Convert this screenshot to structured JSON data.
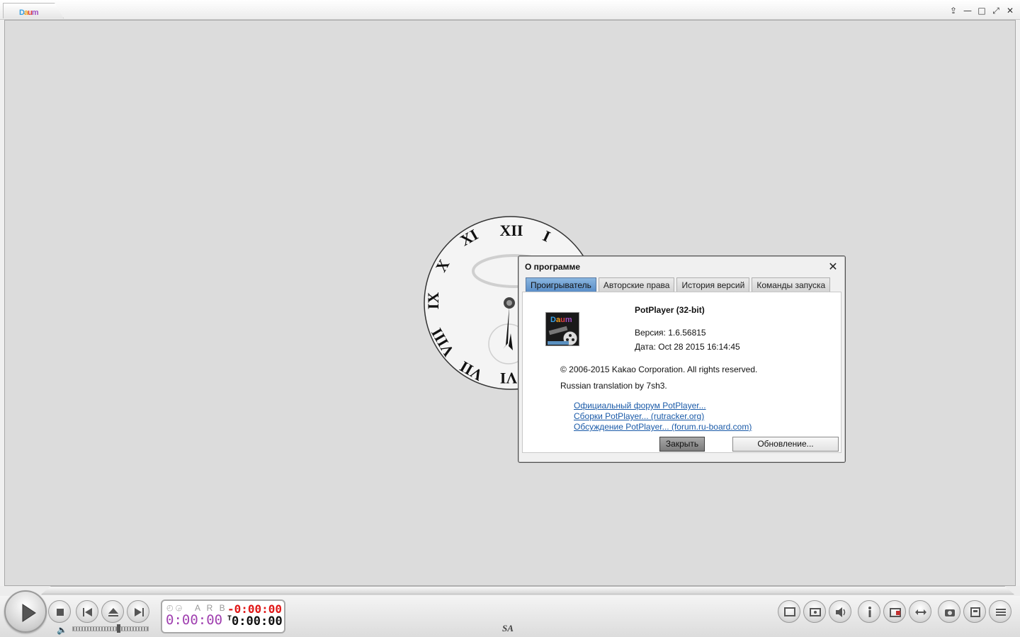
{
  "titlebar": {
    "logo_letters": [
      "D",
      "a",
      "u",
      "m"
    ],
    "buttons": [
      "⇪",
      "—",
      "□",
      "⤢",
      "✕"
    ]
  },
  "dialog": {
    "title": "О программе",
    "close": "✕",
    "tabs": [
      "Проигрыватель",
      "Авторские права",
      "История версий",
      "Команды запуска"
    ],
    "active_tab": 0,
    "product": "PotPlayer (32-bit)",
    "version": "Версия: 1.6.56815",
    "date": "Дата: Oct 28 2015 16:14:45",
    "copyright": "© 2006-2015 Kakao Corporation. All rights reserved.",
    "translation": "Russian translation by 7sh3.",
    "links": [
      "Официальный форум PotPlayer...",
      "Сборки PotPlayer... (rutracker.org)",
      "Обсуждение PotPlayer... (forum.ru-board.com)"
    ],
    "close_button": "Закрыть",
    "update_button": "Обновление..."
  },
  "clock": {
    "numerals": [
      "XII",
      "I",
      "XI",
      "X",
      "IX",
      "VIII",
      "VII",
      "VI"
    ]
  },
  "player": {
    "arb": "A R B",
    "elapsed": "0:00:00",
    "remaining": "-0:00:00",
    "total_prefix": "T",
    "total": "0:00:00",
    "sa_label": "SA",
    "volume_icon": "🔈",
    "mini_icons": "◴ ◶",
    "volume_level": 0.6
  },
  "colors": {
    "elapsed": "#a040b0",
    "remaining": "#e01818",
    "active_tab": "#6a9ed0",
    "link": "#1a5aa8"
  }
}
